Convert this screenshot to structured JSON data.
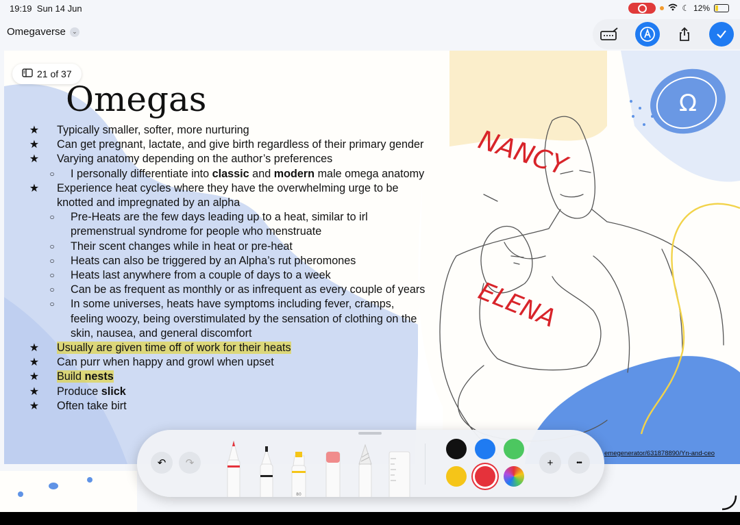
{
  "status": {
    "time": "19:19",
    "date": "Sun 14 Jun",
    "battery": "12%"
  },
  "doc": {
    "title": "Omegaverse"
  },
  "toolbar_top": {
    "icons": [
      "keyboard-pen-icon",
      "markup-icon",
      "share-icon",
      "done-check-icon"
    ]
  },
  "slide": {
    "counter": "21 of 37",
    "heading": "Omegas",
    "logo_symbol": "Ω",
    "credit": "emegenerator/631878890/Yn-and-ceo",
    "handwriting": [
      "NANCY",
      "ELENA"
    ],
    "bullets": [
      {
        "level": 1,
        "marker": "★",
        "text": "Typically smaller, softer, more nurturing"
      },
      {
        "level": 1,
        "marker": "★",
        "text": "Can get pregnant, lactate, and give birth regardless of their primary gender"
      },
      {
        "level": 1,
        "marker": "★",
        "text": "Varying anatomy depending on the author’s preferences"
      },
      {
        "level": 2,
        "marker": "○",
        "pre": "I personally differentiate into ",
        "bold1": "classic",
        "mid": " and ",
        "bold2": "modern",
        "post": " male omega anatomy"
      },
      {
        "level": 1,
        "marker": "★",
        "text": "Experience heat cycles where they have the overwhelming urge to be knotted and impregnated by an alpha"
      },
      {
        "level": 2,
        "marker": "○",
        "text": "Pre-Heats are the few days leading up to a heat, similar to irl premenstrual syndrome for people who menstruate"
      },
      {
        "level": 2,
        "marker": "○",
        "text": "Their scent changes while in heat or pre-heat"
      },
      {
        "level": 2,
        "marker": "○",
        "text": "Heats can also be triggered by an Alpha’s rut pheromones"
      },
      {
        "level": 2,
        "marker": "○",
        "text": "Heats last anywhere from a couple of days to a week"
      },
      {
        "level": 2,
        "marker": "○",
        "text": "Can be as frequent as monthly or as infrequent as every couple of years"
      },
      {
        "level": 2,
        "marker": "○",
        "text": "In some universes, heats have symptoms including fever, cramps, feeling woozy, being overstimulated by the sensation of clothing on the skin, nausea, and general discomfort"
      },
      {
        "level": 1,
        "marker": "★",
        "text": "Usually are given time off of work for their heats",
        "highlight": true
      },
      {
        "level": 1,
        "marker": "★",
        "text": "Can purr when happy and growl when upset"
      },
      {
        "level": 1,
        "marker": "★",
        "pre": "Build ",
        "bold1": "nests",
        "highlight": true
      },
      {
        "level": 1,
        "marker": "★",
        "pre": "Produce ",
        "bold1": "slick"
      },
      {
        "level": 1,
        "marker": "★",
        "text": "Often take birt"
      }
    ]
  },
  "drawing_toolbar": {
    "undo": "↶",
    "redo": "↷",
    "add": "+",
    "more": "•••",
    "highlighter_label": "80",
    "tools": [
      "pen-red",
      "fineliner",
      "highlighter",
      "eraser",
      "pencil",
      "ruler"
    ],
    "colors": [
      "#111111",
      "#1f7bf2",
      "#4cc760",
      "#f5c518",
      "#e5323b",
      "multicolor"
    ],
    "selected_color": "#e5323b"
  }
}
